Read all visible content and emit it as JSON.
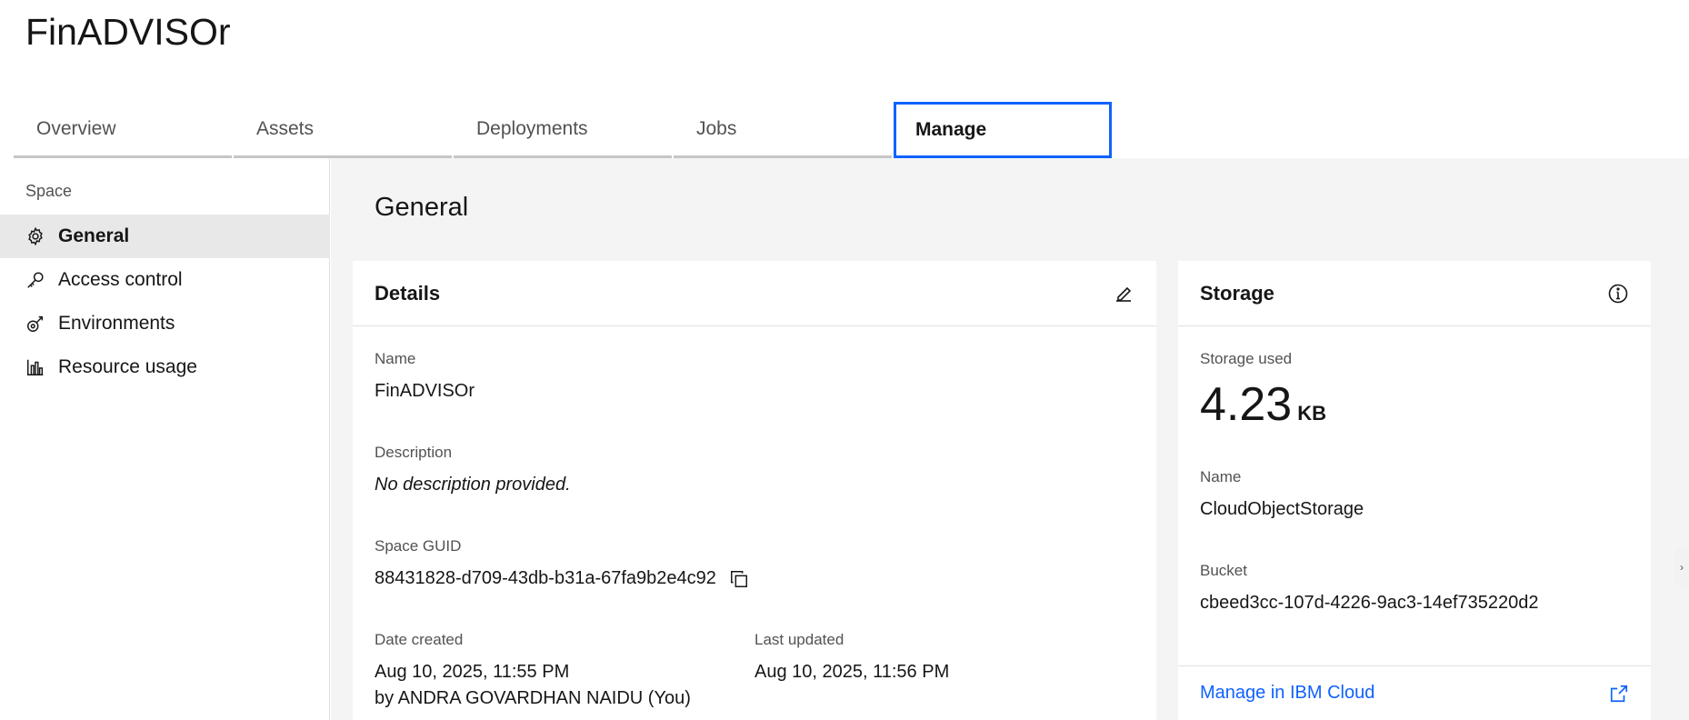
{
  "app": {
    "title": "FinADVISOr"
  },
  "tabs": [
    {
      "label": "Overview",
      "active": false
    },
    {
      "label": "Assets",
      "active": false
    },
    {
      "label": "Deployments",
      "active": false
    },
    {
      "label": "Jobs",
      "active": false
    },
    {
      "label": "Manage",
      "active": true
    }
  ],
  "sidebar": {
    "heading": "Space",
    "items": [
      {
        "label": "General",
        "icon": "gear-icon",
        "active": true
      },
      {
        "label": "Access control",
        "icon": "key-icon",
        "active": false
      },
      {
        "label": "Environments",
        "icon": "environment-icon",
        "active": false
      },
      {
        "label": "Resource usage",
        "icon": "bar-chart-icon",
        "active": false
      }
    ]
  },
  "main": {
    "title": "General",
    "details": {
      "title": "Details",
      "name_label": "Name",
      "name_value": "FinADVISOr",
      "description_label": "Description",
      "description_value": "No description provided.",
      "guid_label": "Space GUID",
      "guid_value": "88431828-d709-43db-b31a-67fa9b2e4c92",
      "created_label": "Date created",
      "created_value": "Aug 10, 2025, 11:55 PM",
      "created_by": "by ANDRA GOVARDHAN NAIDU (You)",
      "updated_label": "Last updated",
      "updated_value": "Aug 10, 2025, 11:56 PM"
    },
    "storage": {
      "title": "Storage",
      "used_label": "Storage used",
      "used_value": "4.23",
      "used_unit": "KB",
      "name_label": "Name",
      "name_value": "CloudObjectStorage",
      "bucket_label": "Bucket",
      "bucket_value": "cbeed3cc-107d-4226-9ac3-14ef735220d2",
      "manage_link": "Manage in IBM Cloud"
    }
  },
  "colors": {
    "accent": "#0f62fe",
    "background": "#f4f4f4"
  }
}
